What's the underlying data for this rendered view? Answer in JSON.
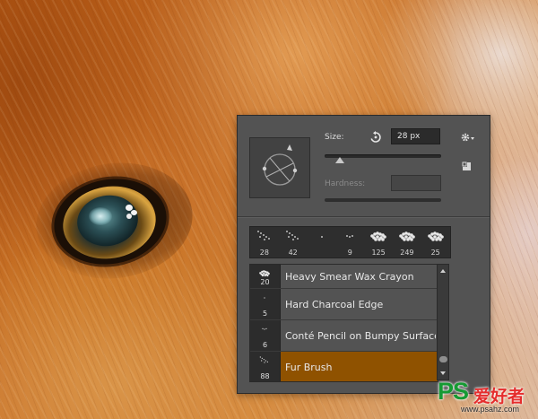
{
  "brush_panel": {
    "size_label": "Size:",
    "size_value": "28 px",
    "hardness_label": "Hardness:",
    "size_slider_fraction": 0.13
  },
  "recent_brushes": [
    {
      "size": "28"
    },
    {
      "size": "42"
    },
    {
      "size": ""
    },
    {
      "size": "9"
    },
    {
      "size": "125"
    },
    {
      "size": "249"
    },
    {
      "size": "25"
    }
  ],
  "presets": [
    {
      "size": "20",
      "name": "Heavy Smear Wax Crayon",
      "selected": false
    },
    {
      "size": "5",
      "name": "Hard Charcoal Edge",
      "selected": false
    },
    {
      "size": "6",
      "name": "Conté Pencil on Bumpy Surface",
      "selected": false
    },
    {
      "size": "88",
      "name": "Fur Brush",
      "selected": true
    }
  ],
  "watermark": {
    "logo": "PS",
    "logo_cn": "爱好者",
    "url": "www.psahz.com"
  },
  "colors": {
    "selected_row": "#8f5200",
    "logo_green": "#169a33",
    "logo_red": "#e52d2d"
  }
}
